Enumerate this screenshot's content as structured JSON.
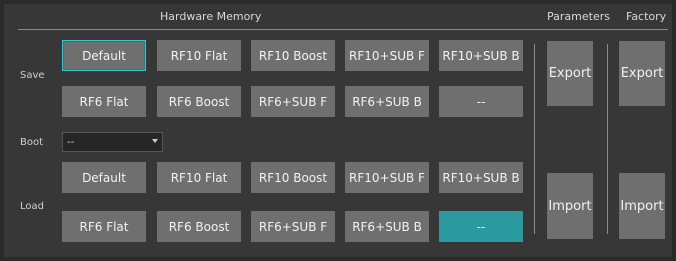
{
  "headers": {
    "hardware_memory": "Hardware Memory",
    "parameters": "Parameters",
    "factory": "Factory"
  },
  "row_labels": {
    "save": "Save",
    "boot": "Boot",
    "load": "Load"
  },
  "save_row1": [
    "Default",
    "RF10 Flat",
    "RF10 Boost",
    "RF10+SUB F",
    "RF10+SUB B"
  ],
  "save_row2": [
    "RF6 Flat",
    "RF6 Boost",
    "RF6+SUB F",
    "RF6+SUB B",
    "--"
  ],
  "load_row1": [
    "Default",
    "RF10 Flat",
    "RF10 Boost",
    "RF10+SUB F",
    "RF10+SUB B"
  ],
  "load_row2": [
    "RF6 Flat",
    "RF6 Boost",
    "RF6+SUB F",
    "RF6+SUB B",
    "--"
  ],
  "boot_select": {
    "value": "--"
  },
  "parameters": {
    "export": "Export",
    "import": "Import"
  },
  "factory": {
    "export": "Export",
    "import": "Import"
  },
  "colors": {
    "background": "#373737",
    "button": "#6f6f6f",
    "selected_border": "#3cc4c8",
    "active_teal": "#2a9aa0"
  }
}
